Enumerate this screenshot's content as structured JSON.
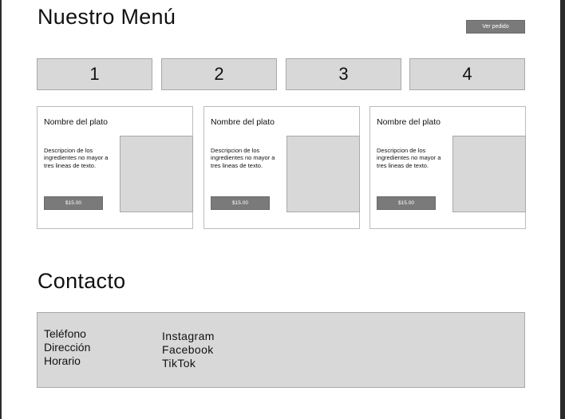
{
  "header": {
    "title": "Nuestro Menú",
    "order_button": "Ver pedido"
  },
  "tabs": [
    {
      "label": "1"
    },
    {
      "label": "2"
    },
    {
      "label": "3"
    },
    {
      "label": "4"
    }
  ],
  "dishes": [
    {
      "name": "Nombre del plato",
      "description": "Descripcion de los ingredientes no mayor a tres lineas de texto.",
      "price": "$15.00"
    },
    {
      "name": "Nombre del plato",
      "description": "Descripcion de los ingredientes no mayor a tres lineas de texto.",
      "price": "$15.00"
    },
    {
      "name": "Nombre del plato",
      "description": "Descripcion de los ingredientes no mayor a tres lineas de texto.",
      "price": "$15.00"
    }
  ],
  "contact": {
    "title": "Contacto",
    "info": [
      "Teléfono",
      "Dirección",
      "Horario"
    ],
    "social": [
      "Instagram",
      "Facebook",
      "TikTok"
    ]
  },
  "colors": {
    "background": "#ffffff",
    "placeholder": "#d8d8d8",
    "button": "#7a7a7a",
    "border": "#a9a9a9"
  }
}
